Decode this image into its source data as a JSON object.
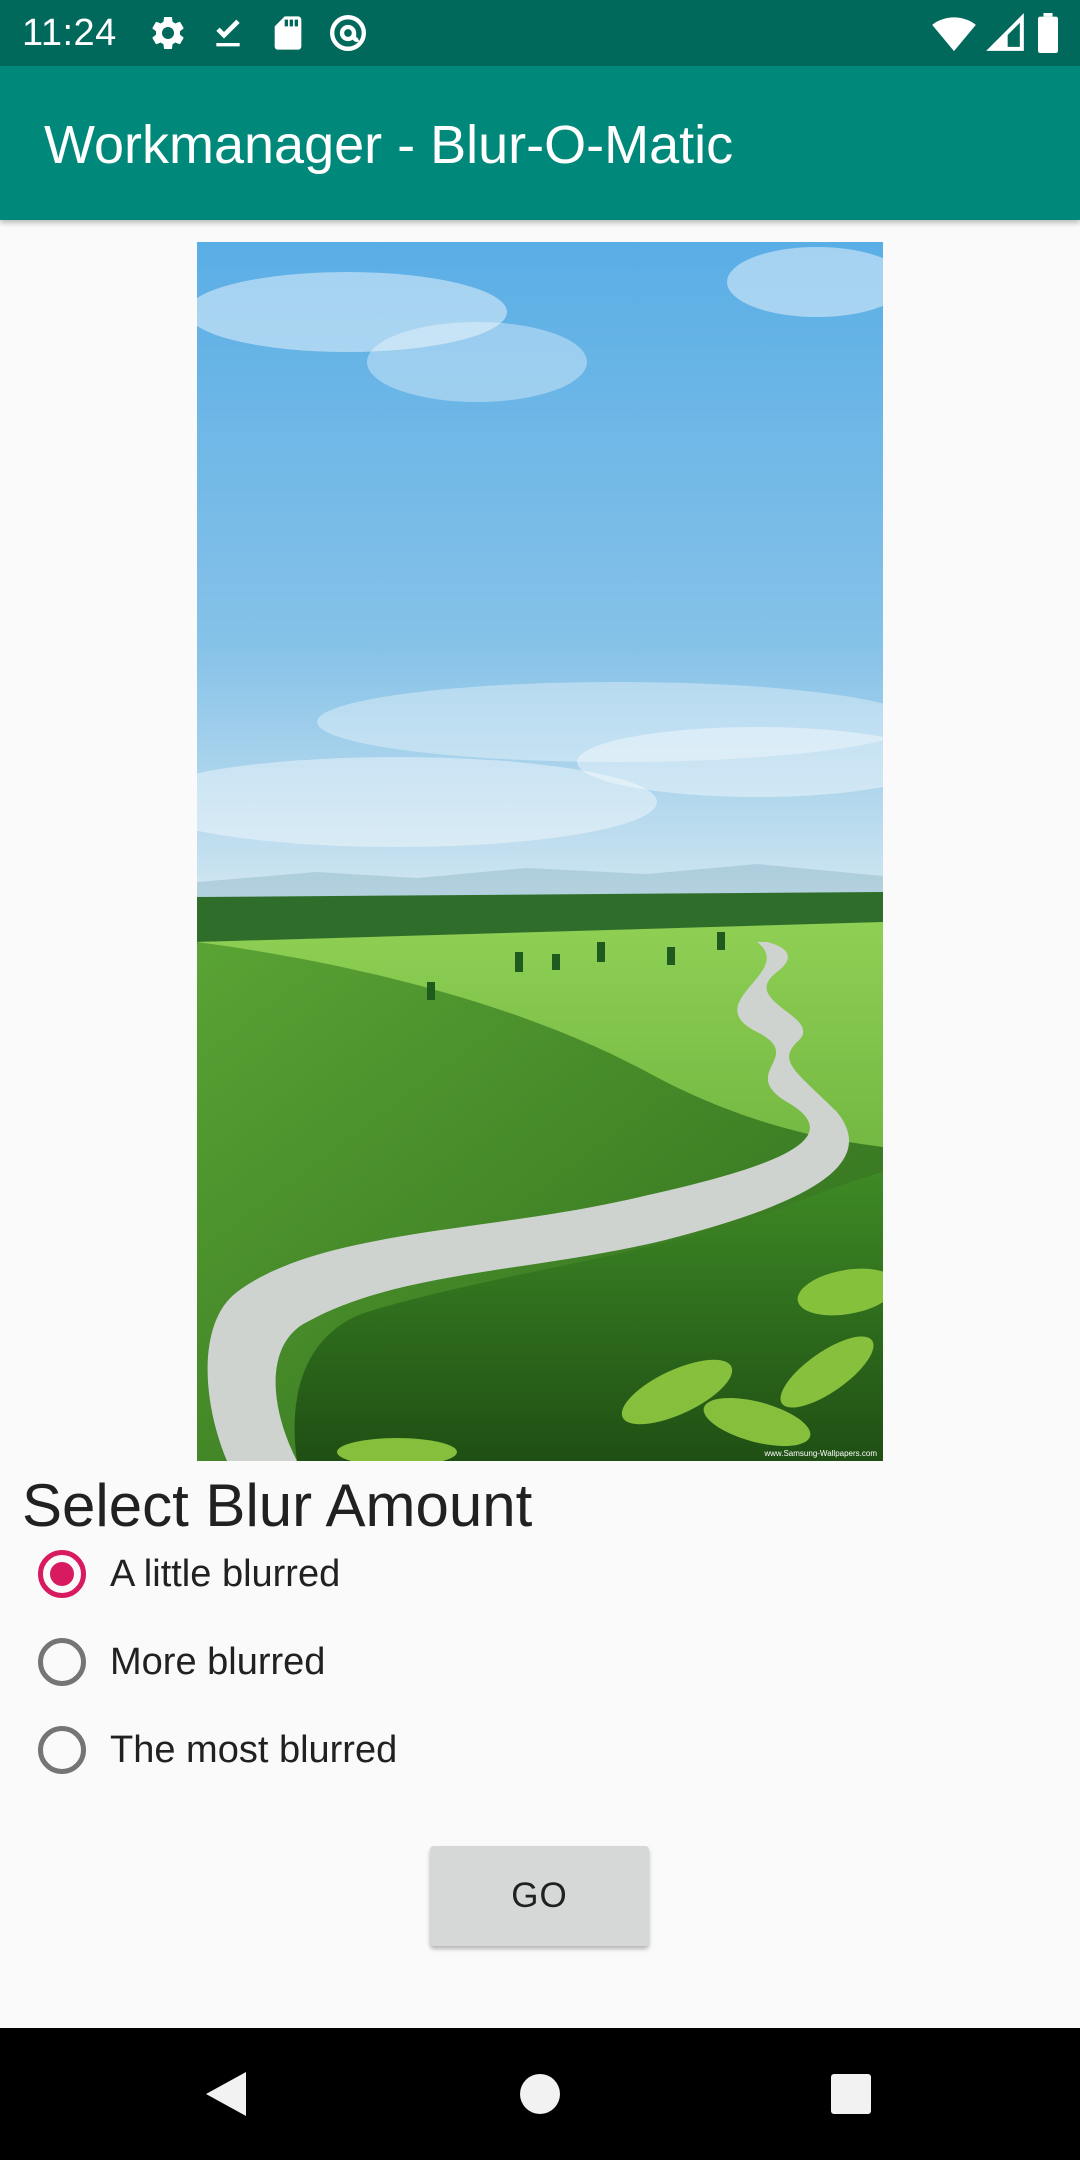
{
  "status_bar": {
    "time": "11:24",
    "left_icons": [
      "settings-icon",
      "download-done-icon",
      "sd-card-icon",
      "at-sign-icon"
    ],
    "right_icons": [
      "wifi-icon",
      "cell-signal-icon",
      "battery-icon"
    ]
  },
  "app_bar": {
    "title": "Workmanager - Blur-O-Matic",
    "color": "#00897b",
    "status_color": "#00695c"
  },
  "image": {
    "description_icon": "landscape-image",
    "credit_text": "www.Samsung-Wallpapers.com"
  },
  "blur_section": {
    "title": "Select Blur Amount",
    "options": [
      {
        "label": "A little blurred",
        "checked": true
      },
      {
        "label": "More blurred",
        "checked": false
      },
      {
        "label": "The most blurred",
        "checked": false
      }
    ],
    "accent_color": "#d81b60"
  },
  "actions": {
    "go_label": "GO"
  },
  "nav_bar": {
    "buttons": [
      "back-icon",
      "home-icon",
      "recents-icon"
    ]
  }
}
